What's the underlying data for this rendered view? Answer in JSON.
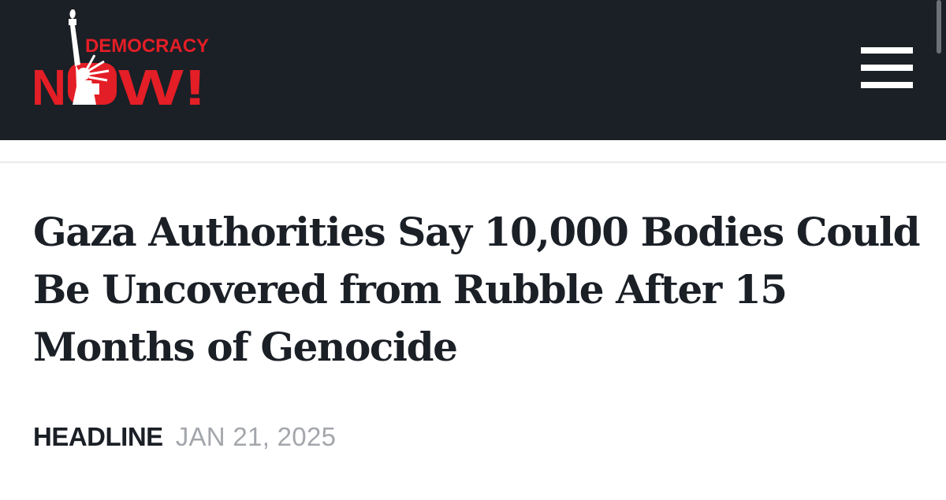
{
  "header": {
    "logo": {
      "line1": "DEMOCRACY",
      "line2_left": "N",
      "line2_right": "W!",
      "icon": "statue-of-liberty-icon",
      "colors": {
        "red": "#e41e26",
        "white": "#ffffff"
      }
    },
    "menu_icon": "hamburger-menu-icon",
    "background_color": "#1b1f26"
  },
  "article": {
    "title": "Gaza Authorities Say 10,000 Bodies Could Be Uncovered from Rubble After 15 Months of Genocide",
    "category": "HEADLINE",
    "date": "JAN 21, 2025"
  },
  "colors": {
    "title_text": "#1b1f26",
    "date_text": "#a3a6ab",
    "divider": "#e9eaee"
  }
}
